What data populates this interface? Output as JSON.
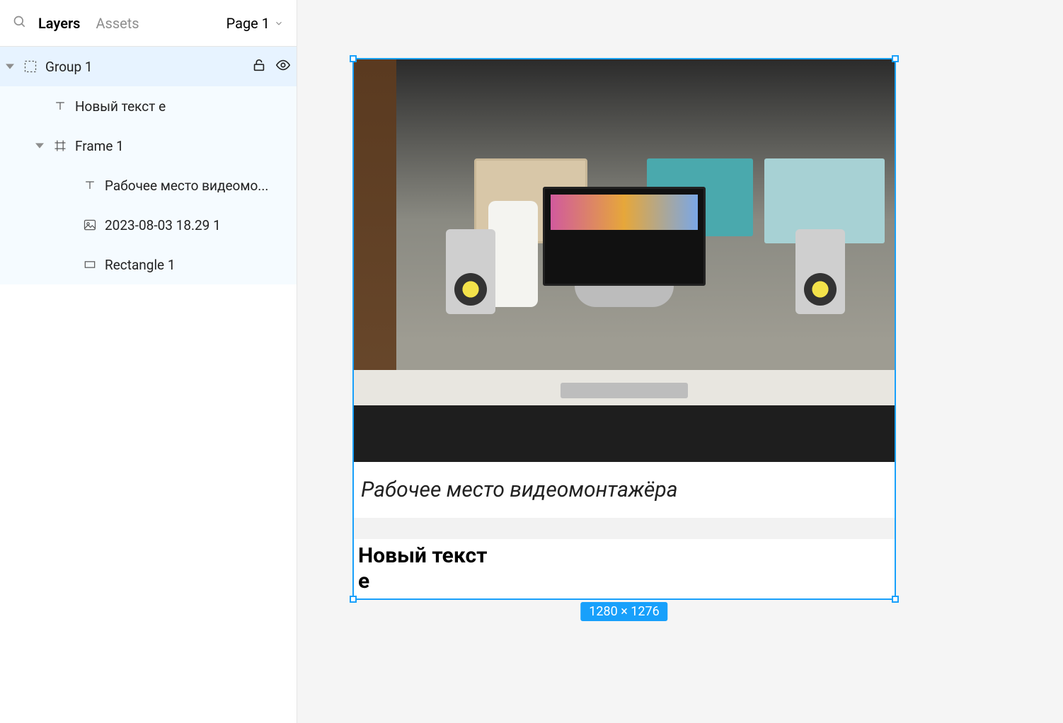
{
  "header": {
    "tabs": {
      "layers": "Layers",
      "assets": "Assets"
    },
    "page_selector": "Page 1"
  },
  "layers": [
    {
      "name": "Group 1",
      "kind": "group",
      "indent": 0,
      "expanded": true,
      "selected": true,
      "show_actions": true
    },
    {
      "name": "Новый текст е",
      "kind": "text",
      "indent": 1,
      "expanded": null,
      "selected": false,
      "show_actions": false
    },
    {
      "name": "Frame 1",
      "kind": "frame",
      "indent": 1,
      "expanded": true,
      "selected": false,
      "show_actions": false
    },
    {
      "name": "Рабочее место видеомо...",
      "kind": "text",
      "indent": 2,
      "expanded": null,
      "selected": false,
      "show_actions": false
    },
    {
      "name": "2023-08-03 18.29 1",
      "kind": "image",
      "indent": 2,
      "expanded": null,
      "selected": false,
      "show_actions": false
    },
    {
      "name": "Rectangle 1",
      "kind": "rectangle",
      "indent": 2,
      "expanded": null,
      "selected": false,
      "show_actions": false
    }
  ],
  "canvas": {
    "selection_dimensions": "1280 × 1276",
    "caption_text": "Рабочее место видеомонтажёра",
    "new_text_line1": "Новый текст",
    "new_text_line2": "е"
  }
}
